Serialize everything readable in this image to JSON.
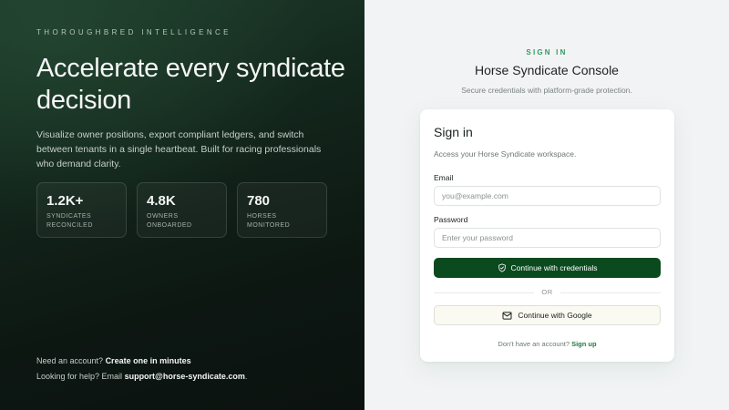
{
  "left": {
    "eyebrow": "THOROUGHBRED INTELLIGENCE",
    "title": "Accelerate every syndicate decision",
    "description": "Visualize owner positions, export compliant ledgers, and switch between tenants in a single heartbeat. Built for racing professionals who demand clarity.",
    "stats": [
      {
        "value": "1.2K+",
        "label": "SYNDICATES RECONCILED"
      },
      {
        "value": "4.8K",
        "label": "OWNERS ONBOARDED"
      },
      {
        "value": "780",
        "label": "HORSES MONITORED"
      }
    ],
    "footer": {
      "account_prefix": "Need an account? ",
      "account_link": "Create one in minutes",
      "help_prefix": "Looking for help? Email ",
      "help_link": "support@horse-syndicate.com",
      "help_suffix": "."
    }
  },
  "right": {
    "eyebrow": "SIGN IN",
    "title": "Horse Syndicate Console",
    "subtitle": "Secure credentials with platform-grade protection.",
    "card": {
      "title": "Sign in",
      "subtitle": "Access your Horse Syndicate workspace.",
      "email_label": "Email",
      "email_placeholder": "you@example.com",
      "password_label": "Password",
      "password_placeholder": "Enter your password",
      "primary_button": "Continue with credentials",
      "divider": "OR",
      "google_button": "Continue with Google",
      "signup_prefix": "Don't have an account? ",
      "signup_link": "Sign up"
    }
  },
  "icons": {
    "primary_button_icon": "shield-check-icon",
    "google_button_icon": "mail-icon"
  },
  "colors": {
    "accent": "#2f9a63",
    "primary_button": "#0b4a1f"
  }
}
